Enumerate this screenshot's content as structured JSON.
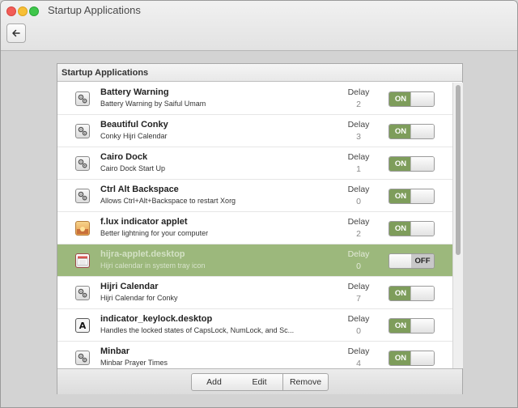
{
  "window": {
    "title": "Startup Applications"
  },
  "panel": {
    "header": "Startup Applications"
  },
  "apps": [
    {
      "name": "Battery Warning",
      "description": "Battery Warning by Saiful Umam",
      "delay_label": "Delay",
      "delay": "2",
      "state": "ON",
      "icon": "gears-icon"
    },
    {
      "name": "Beautiful Conky",
      "description": "Conky Hijri Calendar",
      "delay_label": "Delay",
      "delay": "3",
      "state": "ON",
      "icon": "gears-icon"
    },
    {
      "name": "Cairo Dock",
      "description": "Cairo Dock Start Up",
      "delay_label": "Delay",
      "delay": "1",
      "state": "ON",
      "icon": "gears-icon"
    },
    {
      "name": "Ctrl Alt Backspace",
      "description": "Allows Ctrl+Alt+Backspace to restart Xorg",
      "delay_label": "Delay",
      "delay": "0",
      "state": "ON",
      "icon": "gears-icon"
    },
    {
      "name": "f.lux indicator applet",
      "description": "Better lightning for your computer",
      "delay_label": "Delay",
      "delay": "2",
      "state": "ON",
      "icon": "sunset-icon"
    },
    {
      "name": "hijra-applet.desktop",
      "description": "Hijri calendar in system tray icon",
      "delay_label": "Delay",
      "delay": "0",
      "state": "OFF",
      "icon": "calendar-icon",
      "selected": true
    },
    {
      "name": "Hijri Calendar",
      "description": "Hijri Calendar for Conky",
      "delay_label": "Delay",
      "delay": "7",
      "state": "ON",
      "icon": "gears-icon"
    },
    {
      "name": "indicator_keylock.desktop",
      "description": "Handles the locked states of CapsLock, NumLock, and Sc...",
      "delay_label": "Delay",
      "delay": "0",
      "state": "ON",
      "icon": "letter-a-icon"
    },
    {
      "name": "Minbar",
      "description": "Minbar Prayer Times",
      "delay_label": "Delay",
      "delay": "4",
      "state": "ON",
      "icon": "gears-icon"
    }
  ],
  "toolbar": {
    "add_label": "Add",
    "edit_label": "Edit",
    "remove_label": "Remove"
  },
  "colors": {
    "accent": "#7e9d5b",
    "selected_row": "#9cb87c"
  }
}
